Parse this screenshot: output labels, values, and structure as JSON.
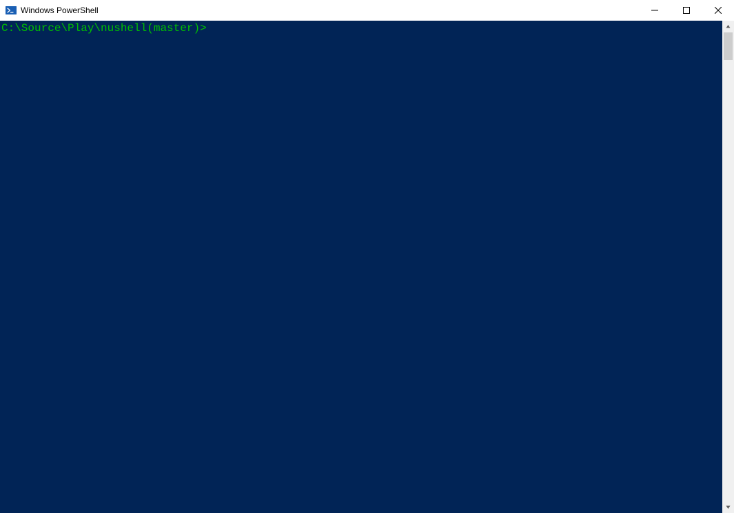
{
  "window": {
    "title": "Windows PowerShell"
  },
  "terminal": {
    "prompt_path": "C:\\Source\\Play\\nushell",
    "prompt_branch_open": "(",
    "prompt_branch": "master",
    "prompt_branch_close": ")",
    "prompt_caret": ">"
  }
}
